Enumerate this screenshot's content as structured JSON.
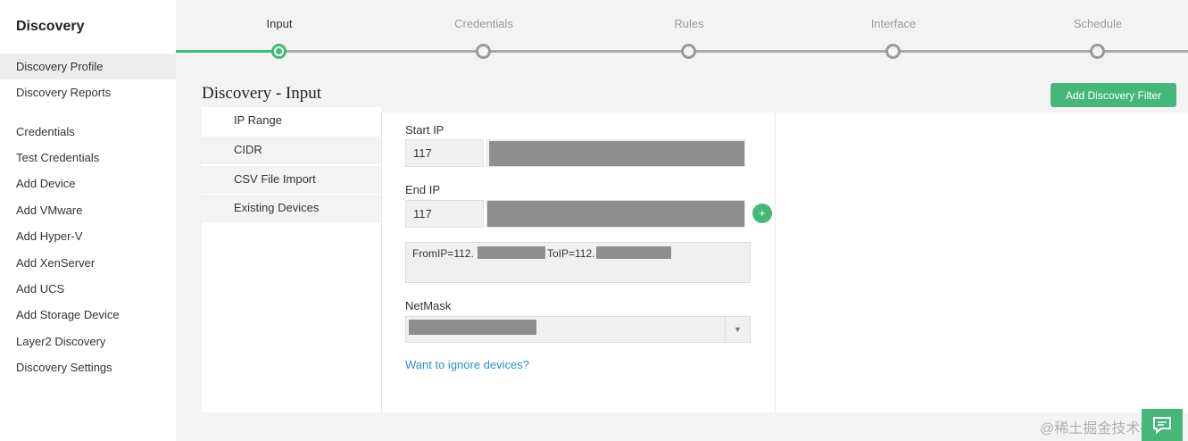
{
  "sidebar": {
    "title": "Discovery",
    "items": [
      {
        "label": "Discovery Profile",
        "active": true
      },
      {
        "label": "Discovery Reports"
      },
      {
        "label": "Credentials"
      },
      {
        "label": "Test Credentials"
      },
      {
        "label": "Add Device"
      },
      {
        "label": "Add VMware"
      },
      {
        "label": "Add Hyper-V"
      },
      {
        "label": "Add XenServer"
      },
      {
        "label": "Add UCS"
      },
      {
        "label": "Add Storage Device"
      },
      {
        "label": "Layer2 Discovery"
      },
      {
        "label": "Discovery Settings"
      }
    ]
  },
  "wizard": {
    "steps": [
      "Input",
      "Credentials",
      "Rules",
      "Interface",
      "Schedule"
    ],
    "current": "Input"
  },
  "page": {
    "title": "Discovery - Input",
    "filter_button": "Add Discovery Filter"
  },
  "tabs": [
    "IP Range",
    "CIDR",
    "CSV File Import",
    "Existing Devices"
  ],
  "form": {
    "start_ip_label": "Start IP",
    "start_ip_prefix": "117",
    "end_ip_label": "End IP",
    "end_ip_prefix": "117",
    "add_symbol": "+",
    "range_from": "FromIP=112.",
    "range_to": "ToIP=112.",
    "netmask_label": "NetMask",
    "select_arrow": "▼",
    "ignore_link": "Want to ignore devices?"
  },
  "watermark": "@稀土掘金技术社区",
  "colors": {
    "accent": "#45b879",
    "link": "#2c8fd0",
    "pending_step": "#9a9a9a"
  },
  "icons": {
    "chat": "chat-bubble-icon",
    "add": "plus-icon",
    "dropdown": "chevron-down-icon"
  }
}
